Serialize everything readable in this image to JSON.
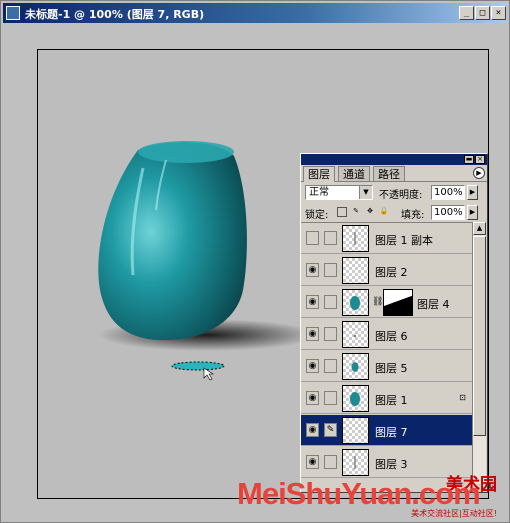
{
  "window": {
    "title": "未标题-1 @ 100% (图层 7, RGB)",
    "buttons": {
      "minimize": "_",
      "maximize": "□",
      "close": "×"
    }
  },
  "layers_panel": {
    "tabs": [
      {
        "label": "图层",
        "active": true
      },
      {
        "label": "通道",
        "active": false
      },
      {
        "label": "路径",
        "active": false
      }
    ],
    "blend_mode": "正常",
    "opacity_label": "不透明度:",
    "opacity_value": "100%",
    "lock_label": "锁定:",
    "fill_label": "填充:",
    "fill_value": "100%",
    "layers": [
      {
        "name": "图层 1 副本",
        "visible": false,
        "selected": false,
        "thumb": "line-icon",
        "locked": false
      },
      {
        "name": "图层 2",
        "visible": true,
        "selected": false,
        "thumb": "empty",
        "locked": false
      },
      {
        "name": "图层 4",
        "visible": true,
        "selected": false,
        "thumb": "vase-icon",
        "locked": false,
        "has_mask": true
      },
      {
        "name": "图层 6",
        "visible": true,
        "selected": false,
        "thumb": "dot-icon",
        "locked": false
      },
      {
        "name": "图层 5",
        "visible": true,
        "selected": false,
        "thumb": "small-vase-icon",
        "locked": false
      },
      {
        "name": "图层 1",
        "visible": true,
        "selected": false,
        "thumb": "vase-icon",
        "locked": true
      },
      {
        "name": "图层 7",
        "visible": true,
        "selected": true,
        "thumb": "empty",
        "locked": false
      },
      {
        "name": "图层 3",
        "visible": true,
        "selected": false,
        "thumb": "line-icon",
        "locked": false
      }
    ]
  },
  "watermark": {
    "main": "MeiShuYuan.com",
    "cn": "美术园",
    "sub": "美术交流社区|互动社区!"
  },
  "colors": {
    "vase": "#1f8a92",
    "selection": "#0a246a",
    "title_gradient_start": "#0a246a"
  }
}
